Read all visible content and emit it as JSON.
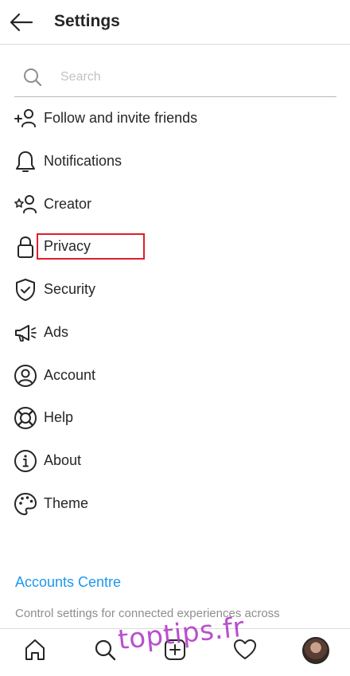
{
  "header": {
    "title": "Settings"
  },
  "search": {
    "placeholder": "Search"
  },
  "menu": [
    {
      "label": "Follow and invite friends",
      "icon": "add-person-icon"
    },
    {
      "label": "Notifications",
      "icon": "bell-icon"
    },
    {
      "label": "Creator",
      "icon": "star-person-icon"
    },
    {
      "label": "Privacy",
      "icon": "lock-icon"
    },
    {
      "label": "Security",
      "icon": "shield-check-icon"
    },
    {
      "label": "Ads",
      "icon": "megaphone-icon"
    },
    {
      "label": "Account",
      "icon": "account-circle-icon"
    },
    {
      "label": "Help",
      "icon": "lifebuoy-icon"
    },
    {
      "label": "About",
      "icon": "info-icon"
    },
    {
      "label": "Theme",
      "icon": "palette-icon"
    }
  ],
  "accounts_centre": {
    "link": "Accounts Centre",
    "description": "Control settings for connected experiences across"
  },
  "watermark": "toptips.fr",
  "colors": {
    "link": "#1a98f0",
    "highlight": "#e01d2a",
    "text": "#262626",
    "watermark": "#b33cc9"
  }
}
